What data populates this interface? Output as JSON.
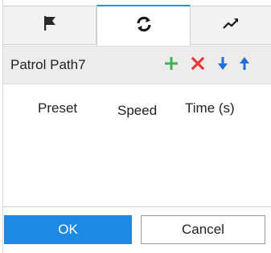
{
  "tabs": [
    {
      "icon": "flag-icon"
    },
    {
      "icon": "refresh-icon",
      "active": true
    },
    {
      "icon": "trend-icon"
    }
  ],
  "toolbar": {
    "path_name": "Patrol Path7",
    "actions": [
      "add-icon",
      "delete-icon",
      "move-down-icon",
      "move-up-icon"
    ]
  },
  "table": {
    "headers": [
      "Preset",
      "Speed",
      "Time (s)"
    ]
  },
  "footer": {
    "ok_label": "OK",
    "cancel_label": "Cancel"
  },
  "colors": {
    "accent": "#1e88e5",
    "add": "#3bb54a",
    "delete": "#e53935",
    "arrows": "#1e6fd9"
  }
}
